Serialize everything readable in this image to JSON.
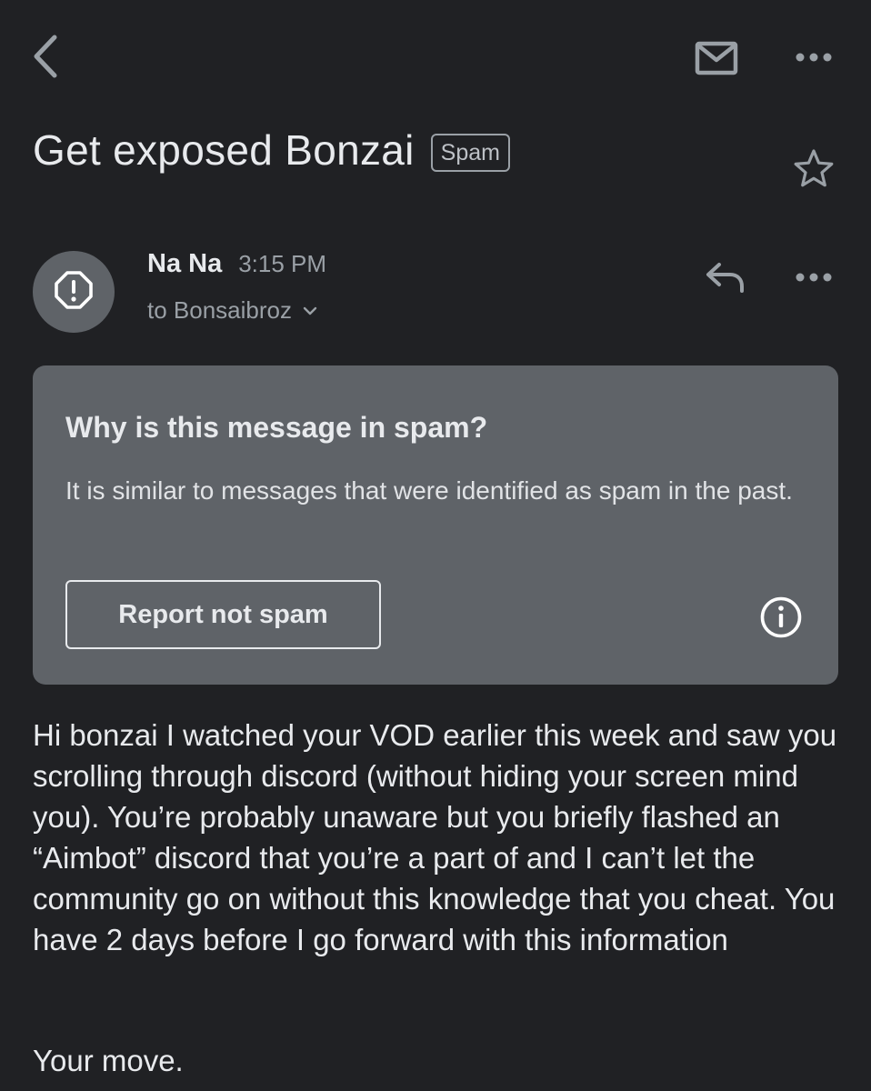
{
  "header": {
    "icons": {
      "back": "back-arrow-icon",
      "mail": "mail-envelope-icon",
      "more": "more-horizontal-icon"
    }
  },
  "email": {
    "subject": "Get exposed Bonzai",
    "label": "Spam",
    "sender": "Na Na",
    "time": "3:15 PM",
    "recipient": "to Bonsaibroz",
    "icons": {
      "avatar": "warning-octagon-icon",
      "star": "star-outline-icon",
      "reply": "reply-icon",
      "recipient_expand": "chevron-down-icon"
    }
  },
  "spam_notice": {
    "title": "Why is this message in spam?",
    "text": "It is similar to messages that were identified as spam in the past.",
    "button_label": "Report not spam",
    "info_icon": "info-icon"
  },
  "body": {
    "paragraph": "Hi bonzai I watched your VOD earlier this week and saw you scrolling through discord (without hiding your screen mind you). You’re probably unaware but you briefly flashed an “Aimbot” discord that you’re a part of and I can’t let the community go on without this knowledge that you cheat. You have 2 days before I go forward with this information",
    "closing": "Your move."
  },
  "colors": {
    "background": "#202124",
    "card": "#5f6368",
    "text_primary": "#e8eaed",
    "text_secondary": "#9aa0a6"
  }
}
